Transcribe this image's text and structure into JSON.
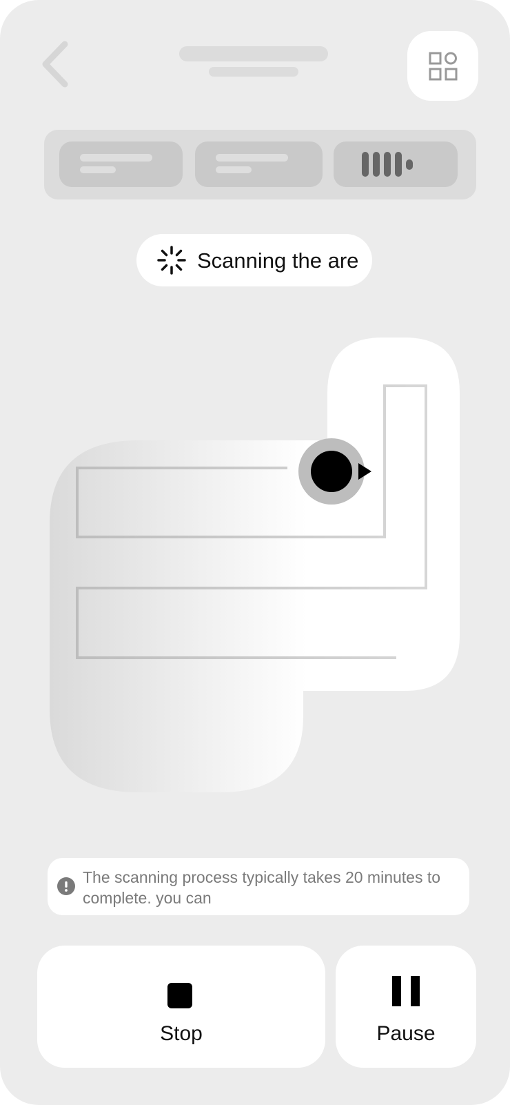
{
  "header": {
    "back_icon": "chevron-left-icon",
    "menu_icon": "grid-icon"
  },
  "mode_tabs": {
    "third_tab_icon": "sound-wave-icon"
  },
  "status": {
    "icon": "loading-spinner-icon",
    "text": "Scanning the are"
  },
  "map": {
    "robot_icon": "robot-vacuum-icon",
    "direction_icon": "direction-arrow-icon"
  },
  "info": {
    "icon": "exclamation-circle-icon",
    "text": "The scanning process typically takes 20 minutes to complete. you can"
  },
  "controls": {
    "stop_label": "Stop",
    "pause_label": "Pause",
    "stop_icon": "stop-icon",
    "pause_icon": "pause-icon"
  },
  "colors": {
    "background": "#ececec",
    "surface": "#ffffff",
    "skeleton": "#dcdcdc",
    "text_primary": "#111111",
    "text_secondary": "#7a7a7a"
  }
}
